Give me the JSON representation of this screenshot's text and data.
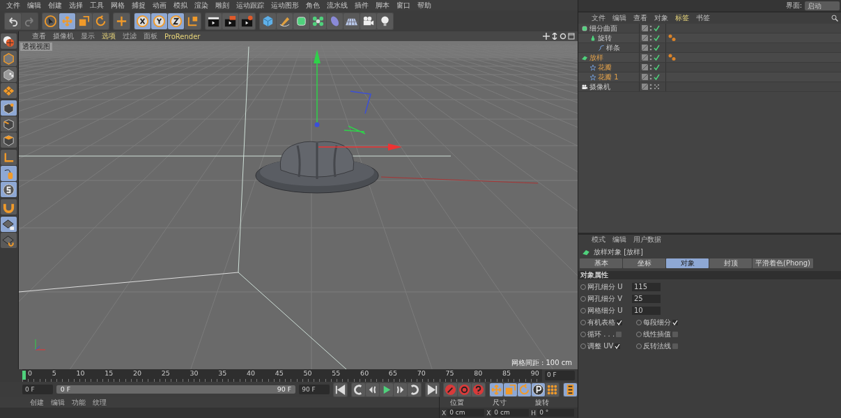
{
  "menu_bar": [
    "文件",
    "编辑",
    "创建",
    "选择",
    "工具",
    "网格",
    "捕捉",
    "动画",
    "模拟",
    "渲染",
    "雕刻",
    "运动跟踪",
    "运动图形",
    "角色",
    "流水线",
    "插件",
    "脚本",
    "窗口",
    "帮助"
  ],
  "layout": {
    "label": "界面:",
    "value": "启动"
  },
  "toolbar": [
    {
      "buttons": [
        {
          "kind": "undo",
          "selected": false,
          "disabled": false
        },
        {
          "kind": "redo",
          "selected": false,
          "disabled": true
        }
      ]
    },
    {
      "buttons": [
        {
          "kind": "select",
          "selected": false,
          "disabled": false
        },
        {
          "kind": "move",
          "selected": true,
          "disabled": false
        },
        {
          "kind": "scale",
          "selected": false,
          "disabled": false
        },
        {
          "kind": "rotate",
          "selected": false,
          "disabled": false
        }
      ]
    },
    {
      "buttons": [
        {
          "kind": "plus",
          "selected": false,
          "disabled": false
        }
      ]
    },
    {
      "buttons": [
        {
          "kind": "x",
          "selected": true,
          "disabled": false
        },
        {
          "kind": "y",
          "selected": true,
          "disabled": false
        },
        {
          "kind": "z",
          "selected": true,
          "disabled": false
        },
        {
          "kind": "coords",
          "selected": false,
          "disabled": false
        }
      ]
    },
    {
      "buttons": [
        {
          "kind": "clapper",
          "selected": false,
          "disabled": false
        },
        {
          "kind": "clapper-view",
          "selected": false,
          "disabled": false
        },
        {
          "kind": "clapper-gear",
          "selected": false,
          "disabled": false
        }
      ]
    },
    {
      "buttons": [
        {
          "kind": "cube",
          "selected": false,
          "disabled": false
        },
        {
          "kind": "pen",
          "selected": false,
          "disabled": false
        },
        {
          "kind": "subdivide",
          "selected": false,
          "disabled": false
        },
        {
          "kind": "cluster",
          "selected": false,
          "disabled": false
        },
        {
          "kind": "bend",
          "selected": false,
          "disabled": false
        },
        {
          "kind": "floor",
          "selected": false,
          "disabled": false
        },
        {
          "kind": "camera",
          "selected": false,
          "disabled": false
        },
        {
          "kind": "bulb",
          "selected": false,
          "disabled": false
        }
      ]
    }
  ],
  "left_toolbar": [
    {
      "buttons": [
        {
          "kind": "sphere-grid",
          "selected": false
        }
      ]
    },
    {
      "buttons": [
        {
          "kind": "cube-outline",
          "selected": false
        },
        {
          "kind": "cube-checker",
          "selected": false
        },
        {
          "kind": "grid-orange",
          "selected": false
        }
      ]
    },
    {
      "buttons": [
        {
          "kind": "cube-point",
          "selected": true
        },
        {
          "kind": "cube-edge",
          "selected": false
        },
        {
          "kind": "cube-face",
          "selected": false
        }
      ]
    },
    {
      "buttons": [
        {
          "kind": "axis",
          "selected": false
        },
        {
          "kind": "mouse",
          "selected": true
        },
        {
          "kind": "snap",
          "selected": true
        }
      ]
    },
    {
      "buttons": [
        {
          "kind": "magnet",
          "selected": false
        }
      ]
    },
    {
      "buttons": [
        {
          "kind": "grid-lock",
          "selected": true
        },
        {
          "kind": "grid-cycle",
          "selected": false
        }
      ]
    }
  ],
  "viewport": {
    "menu": [
      {
        "label": "查看",
        "accent": false
      },
      {
        "label": "摄像机",
        "accent": false
      },
      {
        "label": "显示",
        "accent": false
      },
      {
        "label": "选项",
        "accent": true
      },
      {
        "label": "过滤",
        "accent": false
      },
      {
        "label": "面板",
        "accent": false
      },
      {
        "label": "ProRender",
        "accent": true
      }
    ],
    "view_label": "透视视图",
    "grid_spacing": "网格间距 : 100 cm"
  },
  "timeline": {
    "ticks": [
      "0",
      "5",
      "10",
      "15",
      "20",
      "25",
      "30",
      "35",
      "40",
      "45",
      "50",
      "55",
      "60",
      "65",
      "70",
      "75",
      "80",
      "85",
      "90"
    ],
    "playhead": {
      "level": 0
    },
    "current_frame": "0 F",
    "start": "0 F",
    "range": {
      "level": 1,
      "start": "0 F",
      "end": "90 F"
    },
    "end": "90 F",
    "transport": [
      {
        "buttons": [
          {
            "kind": "to-start",
            "selected": false
          }
        ]
      },
      {
        "buttons": [
          {
            "kind": "prev-key",
            "selected": false
          },
          {
            "kind": "prev-frame",
            "selected": false
          },
          {
            "kind": "play",
            "selected": false
          },
          {
            "kind": "next-frame",
            "selected": false
          },
          {
            "kind": "next-key",
            "selected": false
          }
        ]
      },
      {
        "buttons": [
          {
            "kind": "to-end",
            "selected": false
          }
        ]
      },
      {
        "buttons": [
          {
            "kind": "record",
            "selected": false
          },
          {
            "kind": "autokey",
            "selected": false
          },
          {
            "kind": "keyhelp",
            "selected": false
          }
        ]
      },
      {
        "buttons": [
          {
            "kind": "move",
            "selected": true
          },
          {
            "kind": "scale",
            "selected": true
          },
          {
            "kind": "rotate",
            "selected": true
          },
          {
            "kind": "param",
            "selected": true
          },
          {
            "kind": "dots",
            "selected": false
          }
        ]
      },
      {
        "buttons": [
          {
            "kind": "film",
            "selected": true
          }
        ]
      }
    ]
  },
  "material_manager": {
    "menu": [
      "创建",
      "编辑",
      "功能",
      "纹理"
    ]
  },
  "coordinates": {
    "headers": [
      "位置",
      "尺寸",
      "旋转"
    ],
    "fields": [
      {
        "axis": "X",
        "value": "0 cm"
      },
      {
        "axis": "X",
        "value": "0 cm"
      },
      {
        "axis": "H",
        "value": "0 °"
      }
    ]
  },
  "object_manager": {
    "menu": [
      {
        "label": "文件",
        "selected": false
      },
      {
        "label": "编辑",
        "selected": false
      },
      {
        "label": "查看",
        "selected": false
      },
      {
        "label": "对象",
        "selected": false
      },
      {
        "label": "标签",
        "selected": true
      },
      {
        "label": "书签",
        "selected": false
      }
    ],
    "objects": [
      {
        "name": "细分曲面",
        "kind": "subdivide",
        "selected": false,
        "enabled": true,
        "tag": false,
        "children": [
          {
            "name": "旋转",
            "kind": "lathe",
            "selected": false,
            "enabled": true,
            "tag": true,
            "children": [
              {
                "name": "样条",
                "kind": "spline",
                "selected": false,
                "enabled": true,
                "tag": false
              }
            ]
          }
        ]
      },
      {
        "name": "放样",
        "kind": "loft",
        "selected": true,
        "enabled": true,
        "tag": true,
        "children": [
          {
            "name": "花瓣",
            "kind": "star",
            "selected": true,
            "enabled": true,
            "tag": false
          },
          {
            "name": "花瓣 1",
            "kind": "star",
            "selected": true,
            "enabled": true,
            "tag": false
          }
        ]
      },
      {
        "name": "摄像机",
        "kind": "camera",
        "selected": false,
        "enabled": false,
        "tag": false
      }
    ]
  },
  "attributes": {
    "menu": [
      "模式",
      "编辑",
      "用户数据"
    ],
    "title": "放样对象 [放样]",
    "tabs": [
      {
        "label": "基本",
        "selected": false
      },
      {
        "label": "坐标",
        "selected": false
      },
      {
        "label": "对象",
        "selected": true
      },
      {
        "label": "封顶",
        "selected": false
      },
      {
        "label": "平滑着色(Phong)",
        "selected": false
      }
    ],
    "section": "对象属性",
    "numbers": [
      {
        "label": "网孔细分 U",
        "value": "115",
        "keyframed": false
      },
      {
        "label": "网孔细分 V",
        "value": "25",
        "keyframed": false
      },
      {
        "label": "网格细分 U",
        "value": "10",
        "keyframed": false
      }
    ],
    "checks": [
      [
        {
          "label": "有机表格",
          "checked": true,
          "keyframed": false
        },
        {
          "label": "每段细分",
          "checked": true,
          "keyframed": false
        }
      ],
      [
        {
          "label": "循环 . . .",
          "checked": false,
          "keyframed": false
        },
        {
          "label": "线性插值",
          "checked": false,
          "keyframed": false
        }
      ],
      [
        {
          "label": "调整 UV",
          "checked": true,
          "keyframed": false
        },
        {
          "label": "反转法线",
          "checked": false,
          "keyframed": false
        }
      ]
    ]
  }
}
